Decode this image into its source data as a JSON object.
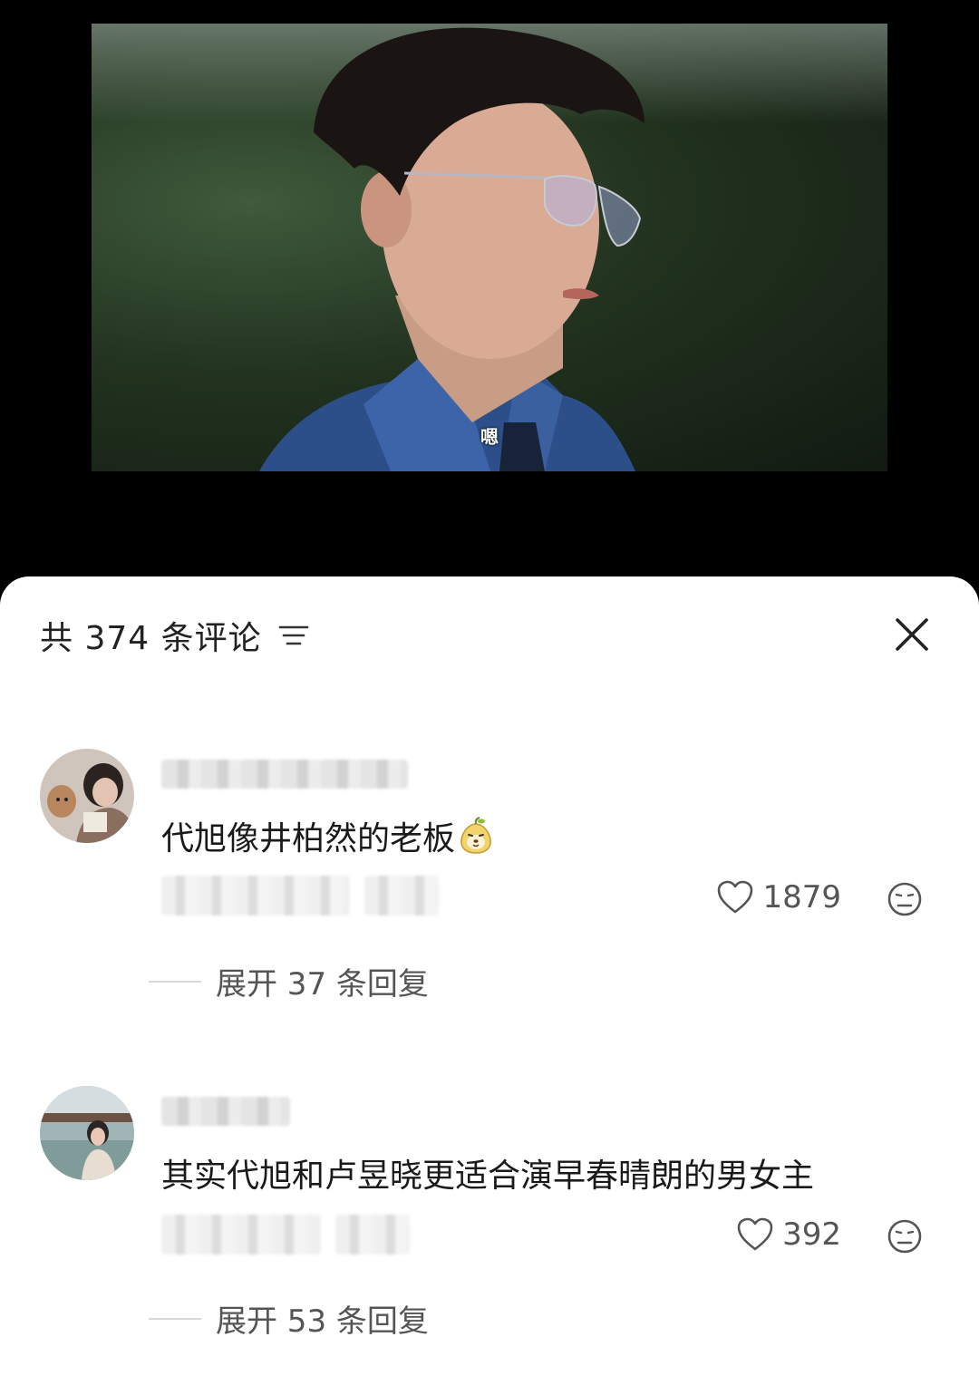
{
  "video": {
    "subtitle": "嗯"
  },
  "comments_sheet": {
    "title": "共 374 条评论",
    "sort_icon": "sort-lines-icon",
    "close_icon": "close-icon",
    "comments": [
      {
        "text": "代旭像井柏然的老板",
        "emoji": "pear-face-emoji",
        "likes": "1879",
        "expand_label": "展开 37 条回复"
      },
      {
        "text": "其实代旭和卢昱晓更适合演早春晴朗的男女主",
        "likes": "392",
        "expand_label": "展开 53 条回复"
      }
    ]
  }
}
